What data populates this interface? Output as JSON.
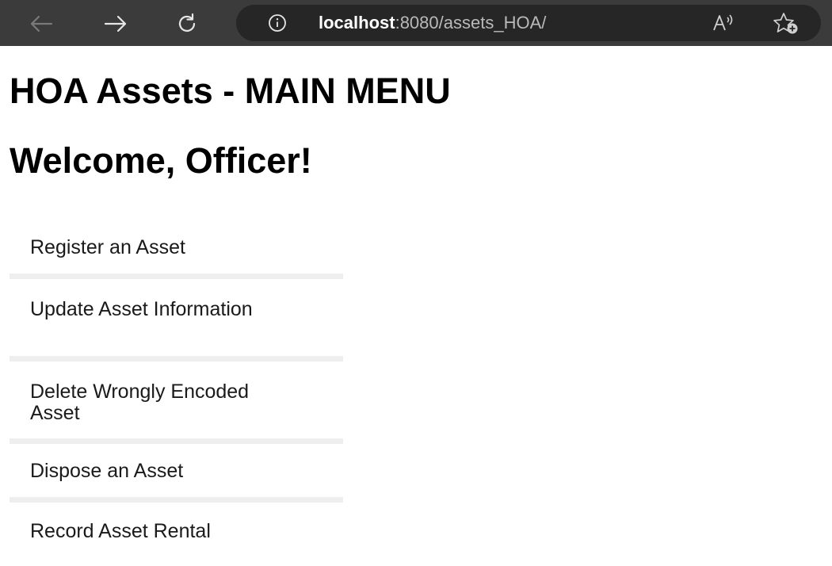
{
  "browser": {
    "url_host": "localhost",
    "url_rest": ":8080/assets_HOA/",
    "icons": [
      "back-arrow-icon",
      "forward-arrow-icon",
      "refresh-icon",
      "info-icon",
      "read-aloud-icon",
      "favorites-add-icon"
    ]
  },
  "page": {
    "title": "HOA Assets - MAIN MENU",
    "welcome": "Welcome, Officer!"
  },
  "menu": {
    "items": [
      {
        "label": "Register an Asset"
      },
      {
        "label": "Update Asset Information"
      },
      {
        "label": "Delete Wrongly Encoded Asset"
      },
      {
        "label": "Dispose an Asset"
      },
      {
        "label": "Record Asset Rental"
      }
    ]
  },
  "colors": {
    "browser_bar": "#3b3b3b",
    "address_bar": "#262626",
    "menu_divider": "#eeeeee",
    "text": "#000000"
  }
}
